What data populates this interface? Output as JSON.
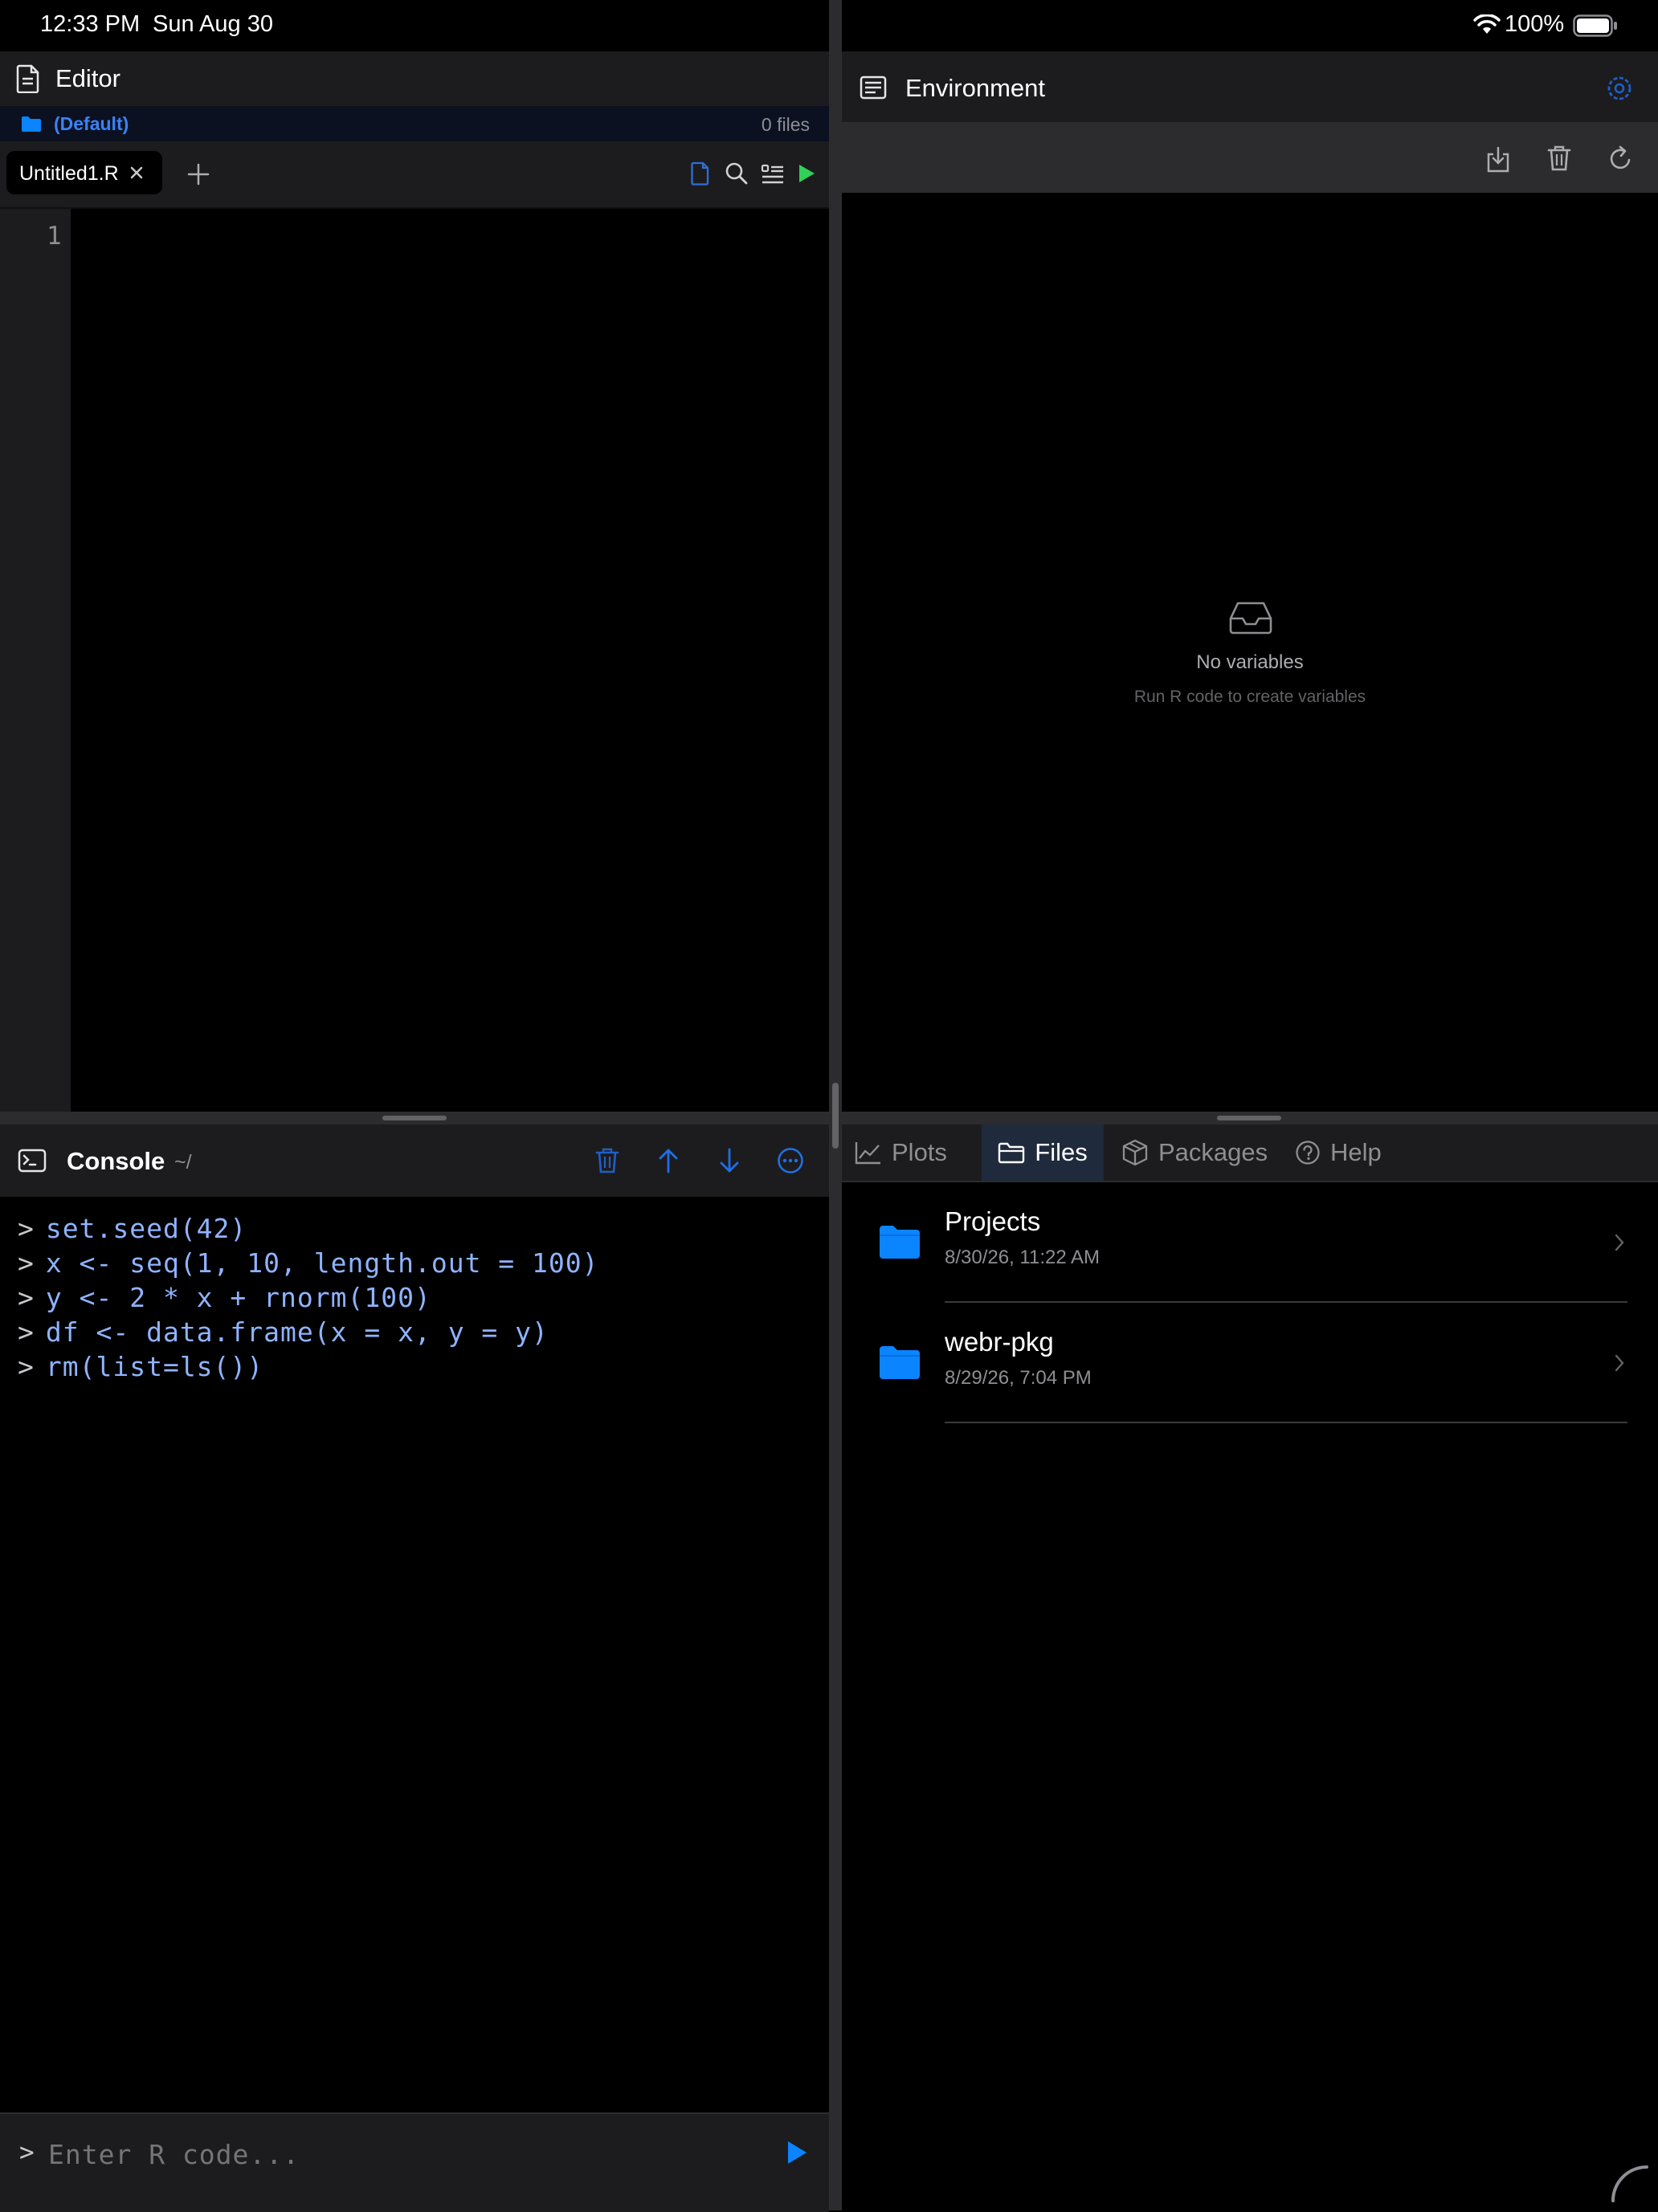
{
  "status_bar": {
    "time": "12:33 PM",
    "date": "Sun Aug 30",
    "battery": "100%"
  },
  "editor": {
    "title": "Editor",
    "project": {
      "name": "(Default)",
      "file_count": "0 files"
    },
    "tabs": [
      {
        "label": "Untitled1.R"
      }
    ],
    "line_numbers": [
      "1"
    ]
  },
  "console": {
    "title": "Console",
    "path": "~/",
    "prompt_symbol": ">",
    "lines": [
      "set.seed(42)",
      "x <- seq(1, 10, length.out = 100)",
      "y <- 2 * x + rnorm(100)",
      "df <- data.frame(x = x, y = y)",
      "rm(list=ls())"
    ],
    "input_placeholder": "Enter R code..."
  },
  "environment": {
    "title": "Environment",
    "empty_title": "No variables",
    "empty_subtitle": "Run R code to create variables"
  },
  "bottom_panel": {
    "tabs": [
      {
        "label": "Plots",
        "icon": "chart-line-icon"
      },
      {
        "label": "Files",
        "icon": "folder-icon",
        "active": true
      },
      {
        "label": "Packages",
        "icon": "box-icon"
      },
      {
        "label": "Help",
        "icon": "question-circle-icon"
      }
    ],
    "files": [
      {
        "name": "Projects",
        "date": "8/30/26, 11:22 AM"
      },
      {
        "name": "webr-pkg",
        "date": "8/29/26, 7:04 PM"
      }
    ]
  },
  "colors": {
    "accent": "#0a84ff",
    "run_green": "#30d158",
    "console_code": "#8fb3ff",
    "panel": "#1c1c1e",
    "toolbar": "#2c2c2e"
  }
}
